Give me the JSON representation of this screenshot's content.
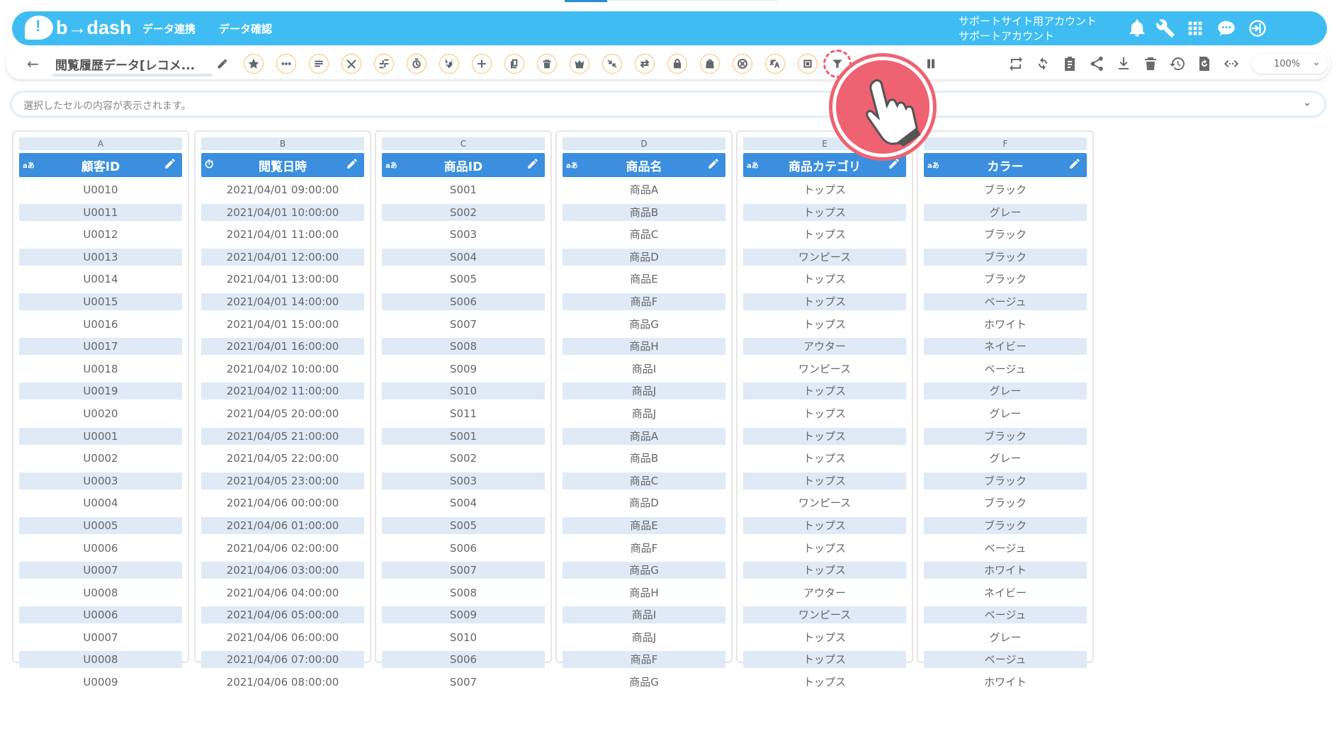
{
  "header": {
    "logo_text": "b→dash",
    "nav": [
      "データ連携",
      "データ確認"
    ],
    "account_line1": "サポートサイト用アカウント",
    "account_line2": "サポートアカウント"
  },
  "toolbar": {
    "title": "閲覧履歴データ[レコメ...",
    "zoom": "100%"
  },
  "cellbar": {
    "placeholder": "選択したセルの内容が表示されます。"
  },
  "table": {
    "columns": [
      {
        "letter": "A",
        "type": "aあ",
        "name": "顧客ID",
        "values": [
          "U0010",
          "U0011",
          "U0012",
          "U0013",
          "U0014",
          "U0015",
          "U0016",
          "U0017",
          "U0018",
          "U0019",
          "U0020",
          "U0001",
          "U0002",
          "U0003",
          "U0004",
          "U0005",
          "U0006",
          "U0007",
          "U0008",
          "U0006",
          "U0007",
          "U0008",
          "U0009"
        ]
      },
      {
        "letter": "B",
        "type": "clock",
        "name": "閲覧日時",
        "values": [
          "2021/04/01 09:00:00",
          "2021/04/01 10:00:00",
          "2021/04/01 11:00:00",
          "2021/04/01 12:00:00",
          "2021/04/01 13:00:00",
          "2021/04/01 14:00:00",
          "2021/04/01 15:00:00",
          "2021/04/01 16:00:00",
          "2021/04/02 10:00:00",
          "2021/04/02 11:00:00",
          "2021/04/05 20:00:00",
          "2021/04/05 21:00:00",
          "2021/04/05 22:00:00",
          "2021/04/05 23:00:00",
          "2021/04/06 00:00:00",
          "2021/04/06 01:00:00",
          "2021/04/06 02:00:00",
          "2021/04/06 03:00:00",
          "2021/04/06 04:00:00",
          "2021/04/06 05:00:00",
          "2021/04/06 06:00:00",
          "2021/04/06 07:00:00",
          "2021/04/06 08:00:00"
        ]
      },
      {
        "letter": "C",
        "type": "aあ",
        "name": "商品ID",
        "values": [
          "S001",
          "S002",
          "S003",
          "S004",
          "S005",
          "S006",
          "S007",
          "S008",
          "S009",
          "S010",
          "S011",
          "S001",
          "S002",
          "S003",
          "S004",
          "S005",
          "S006",
          "S007",
          "S008",
          "S009",
          "S010",
          "S006",
          "S007"
        ]
      },
      {
        "letter": "D",
        "type": "aあ",
        "name": "商品名",
        "values": [
          "商品A",
          "商品B",
          "商品C",
          "商品D",
          "商品E",
          "商品F",
          "商品G",
          "商品H",
          "商品I",
          "商品J",
          "商品J",
          "商品A",
          "商品B",
          "商品C",
          "商品D",
          "商品E",
          "商品F",
          "商品G",
          "商品H",
          "商品I",
          "商品J",
          "商品F",
          "商品G"
        ]
      },
      {
        "letter": "E",
        "type": "aあ",
        "name": "商品カテゴリ",
        "values": [
          "トップス",
          "トップス",
          "トップス",
          "ワンピース",
          "トップス",
          "トップス",
          "トップス",
          "アウター",
          "ワンピース",
          "トップス",
          "トップス",
          "トップス",
          "トップス",
          "トップス",
          "ワンピース",
          "トップス",
          "トップス",
          "トップス",
          "アウター",
          "ワンピース",
          "トップス",
          "トップス",
          "トップス"
        ]
      },
      {
        "letter": "F",
        "type": "aあ",
        "name": "カラー",
        "values": [
          "ブラック",
          "グレー",
          "ブラック",
          "ブラック",
          "ブラック",
          "ベージュ",
          "ホワイト",
          "ネイビー",
          "ベージュ",
          "グレー",
          "グレー",
          "ブラック",
          "グレー",
          "ブラック",
          "ブラック",
          "ブラック",
          "ベージュ",
          "ホワイト",
          "ネイビー",
          "ベージュ",
          "グレー",
          "ベージュ",
          "ホワイト"
        ]
      }
    ]
  }
}
